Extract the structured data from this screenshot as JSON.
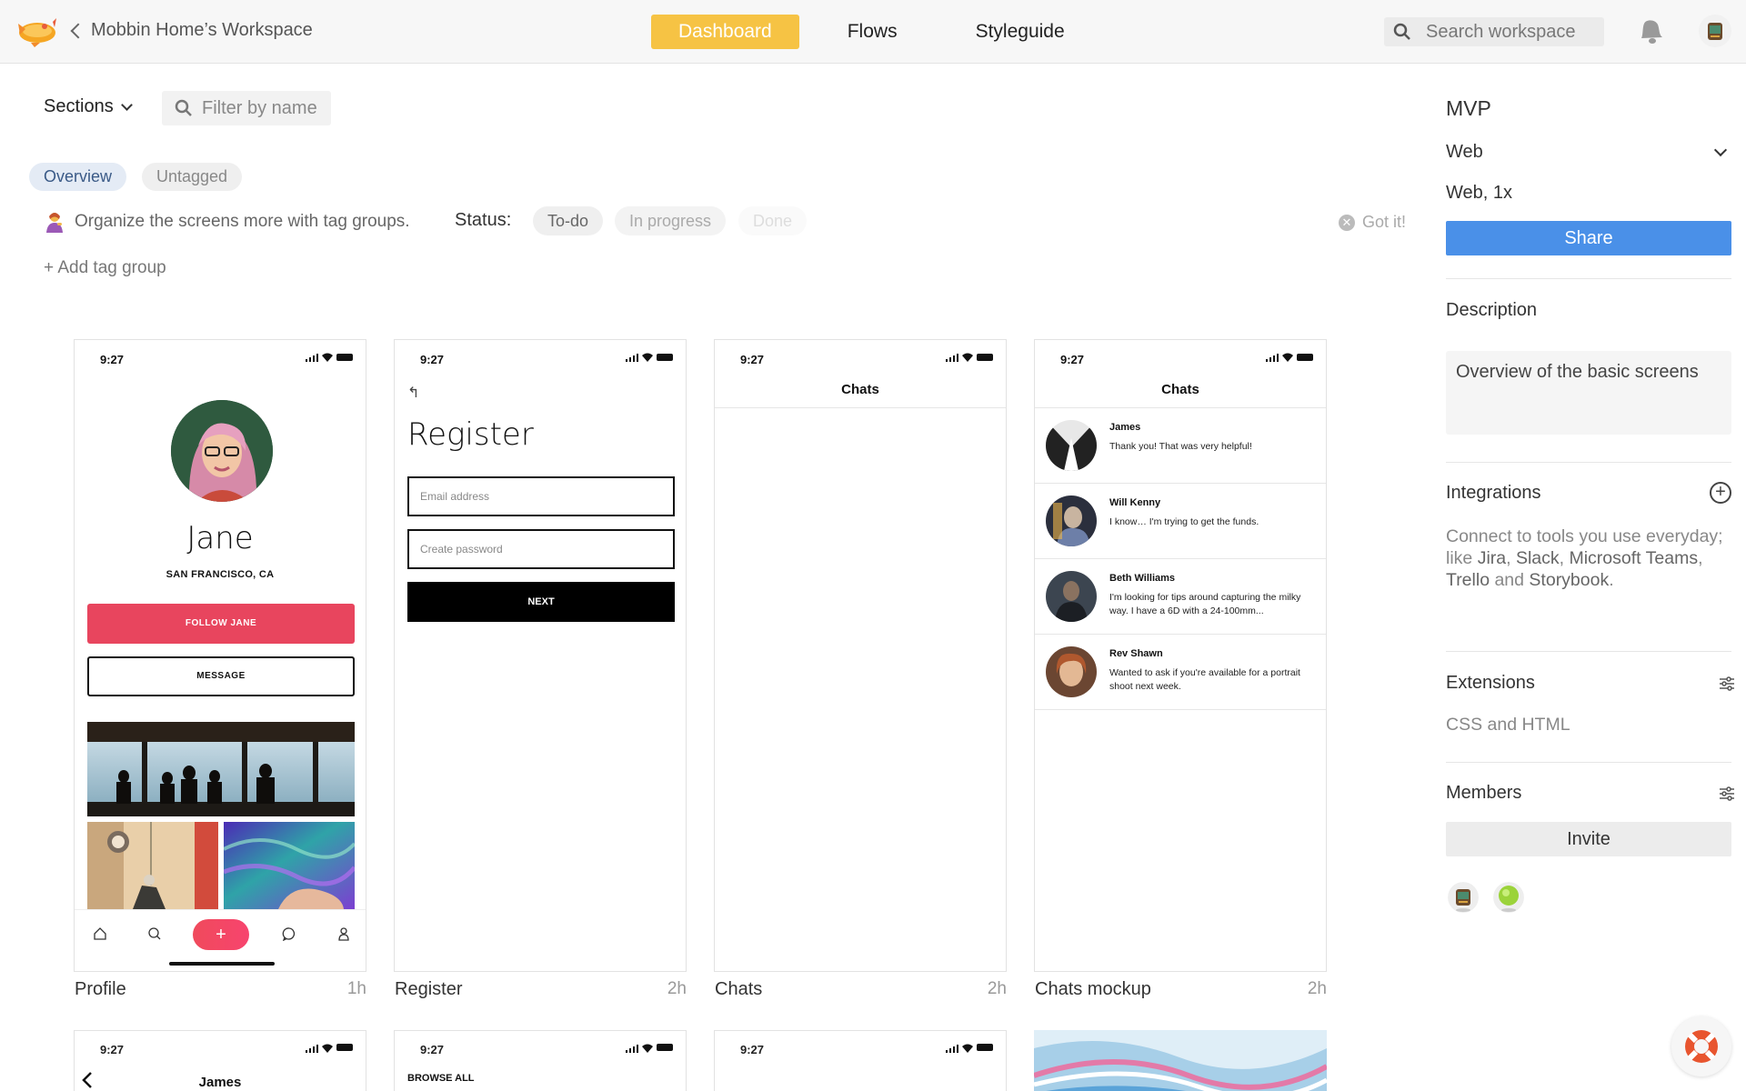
{
  "topbar": {
    "back_label": "Mobbin Home’s Workspace",
    "tabs": [
      {
        "label": "Dashboard",
        "active": true
      },
      {
        "label": "Flows",
        "active": false
      },
      {
        "label": "Styleguide",
        "active": false
      }
    ],
    "search_placeholder": "Search workspace",
    "accent_color": "#f6c344"
  },
  "filters": {
    "sections_label": "Sections",
    "filter_placeholder": "Filter by name",
    "tags": [
      {
        "label": "Overview",
        "active": true
      },
      {
        "label": "Untagged",
        "active": false
      }
    ],
    "hint": "Organize the screens more with tag groups.",
    "status_label": "Status:",
    "statuses": [
      "To-do",
      "In progress",
      "Done"
    ],
    "got_it": "Got it!",
    "add_tag_group": "+ Add tag group"
  },
  "screens": [
    {
      "caption": "Profile",
      "age": "1h",
      "time": "9:27",
      "name": "Jane",
      "location": "SAN FRANCISCO, CA",
      "follow_label": "FOLLOW JANE",
      "message_label": "MESSAGE",
      "plus": "+"
    },
    {
      "caption": "Register",
      "age": "2h",
      "time": "9:27",
      "back": "↰",
      "title": "Register",
      "email_placeholder": "Email address",
      "password_placeholder": "Create password",
      "next_label": "NEXT"
    },
    {
      "caption": "Chats",
      "age": "2h",
      "time": "9:27",
      "header": "Chats"
    },
    {
      "caption": "Chats mockup",
      "age": "2h",
      "time": "9:27",
      "header": "Chats",
      "chats": [
        {
          "name": "James",
          "message": "Thank you! That was very helpful!"
        },
        {
          "name": "Will Kenny",
          "message": "I know… I'm trying to get the funds."
        },
        {
          "name": "Beth Williams",
          "message": "I'm looking for tips around capturing the milky way. I have a 6D with a 24-100mm..."
        },
        {
          "name": "Rev Shawn",
          "message": "Wanted to ask if you're available for a portrait shoot next week."
        }
      ]
    }
  ],
  "row2": [
    {
      "time": "9:27",
      "label": "James"
    },
    {
      "time": "9:27",
      "label": "BROWSE ALL"
    },
    {
      "time": "9:27",
      "label": ""
    }
  ],
  "panel": {
    "title": "MVP",
    "platform": "Web",
    "density": "Web, 1x",
    "share_label": "Share",
    "description_heading": "Description",
    "description": "Overview of the basic screens",
    "integrations_heading": "Integrations",
    "integrations_text_1": "Connect to tools you use everyday; like ",
    "integrations_tools": [
      "Jira",
      "Slack",
      "Microsoft Teams",
      "Trello",
      "Storybook"
    ],
    "extensions_heading": "Extensions",
    "extensions_text": "CSS and HTML",
    "members_heading": "Members",
    "invite_label": "Invite",
    "share_color": "#4a90e8"
  }
}
